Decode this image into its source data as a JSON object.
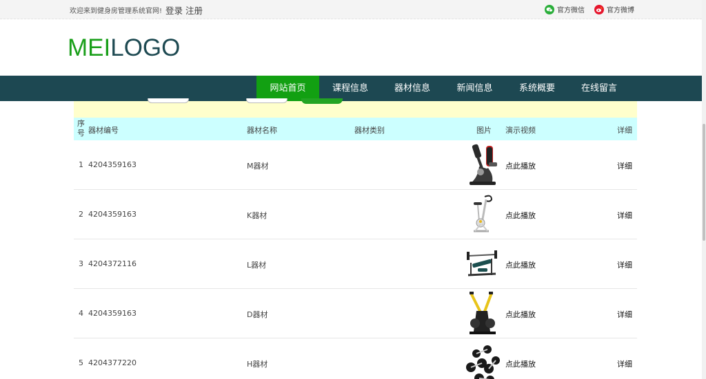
{
  "topbar": {
    "welcome": "欢迎来到健身房管理系统官网!",
    "login": "登录",
    "register": "注册",
    "wechat": "官方微信",
    "weibo": "官方微博"
  },
  "logo": {
    "part1": "MEI",
    "part2": "LOGO"
  },
  "nav": {
    "items": [
      {
        "label": "网站首页",
        "active": true
      },
      {
        "label": "课程信息"
      },
      {
        "label": "器材信息"
      },
      {
        "label": "新闻信息"
      },
      {
        "label": "系统概要"
      },
      {
        "label": "在线留言"
      }
    ]
  },
  "table": {
    "headers": {
      "index": "序号",
      "code": "器材编号",
      "name": "器材名称",
      "category": "器材类别",
      "image": "图片",
      "video": "演示视频",
      "detail": "详细"
    },
    "rows": [
      {
        "index": "1",
        "code": "4204359163",
        "name": "M器材",
        "category": "",
        "image": "recumbent-bike",
        "video": "点此播放",
        "detail": "详细"
      },
      {
        "index": "2",
        "code": "4204359163",
        "name": "K器材",
        "category": "",
        "image": "upright-bike",
        "video": "点此播放",
        "detail": "详细"
      },
      {
        "index": "3",
        "code": "4204372116",
        "name": "L器材",
        "category": "",
        "image": "weight-bench",
        "video": "点此播放",
        "detail": "详细"
      },
      {
        "index": "4",
        "code": "4204359163",
        "name": "D器材",
        "category": "",
        "image": "lat-pulldown",
        "video": "点此播放",
        "detail": "详细"
      },
      {
        "index": "5",
        "code": "4204377220",
        "name": "H器材",
        "category": "",
        "image": "dumbbells",
        "video": "点此播放",
        "detail": "详细"
      }
    ]
  },
  "colors": {
    "brand_green": "#12a012",
    "nav_bg": "#1d4852",
    "header_row_bg": "#ccffff",
    "filter_bg": "#ffffcc"
  }
}
